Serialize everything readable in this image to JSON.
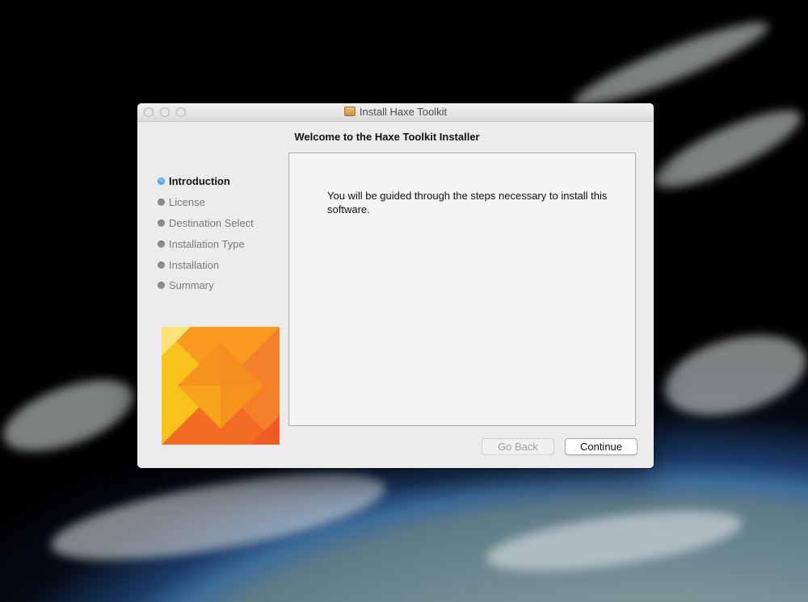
{
  "window": {
    "title": "Install Haxe Toolkit",
    "heading": "Welcome to the Haxe Toolkit Installer"
  },
  "steps": [
    {
      "label": "Introduction",
      "active": true
    },
    {
      "label": "License",
      "active": false
    },
    {
      "label": "Destination Select",
      "active": false
    },
    {
      "label": "Installation Type",
      "active": false
    },
    {
      "label": "Installation",
      "active": false
    },
    {
      "label": "Summary",
      "active": false
    }
  ],
  "content": {
    "body": "You will be guided through the steps necessary to install this software."
  },
  "buttons": {
    "back_label": "Go Back",
    "continue_label": "Continue"
  },
  "colors": {
    "logo_orange": "#f7921e",
    "logo_yellow": "#fbb91a",
    "active_step_dot": "#1a86e0"
  },
  "icons": {
    "window_icon": "package-icon",
    "logo": "haxe-logo"
  }
}
